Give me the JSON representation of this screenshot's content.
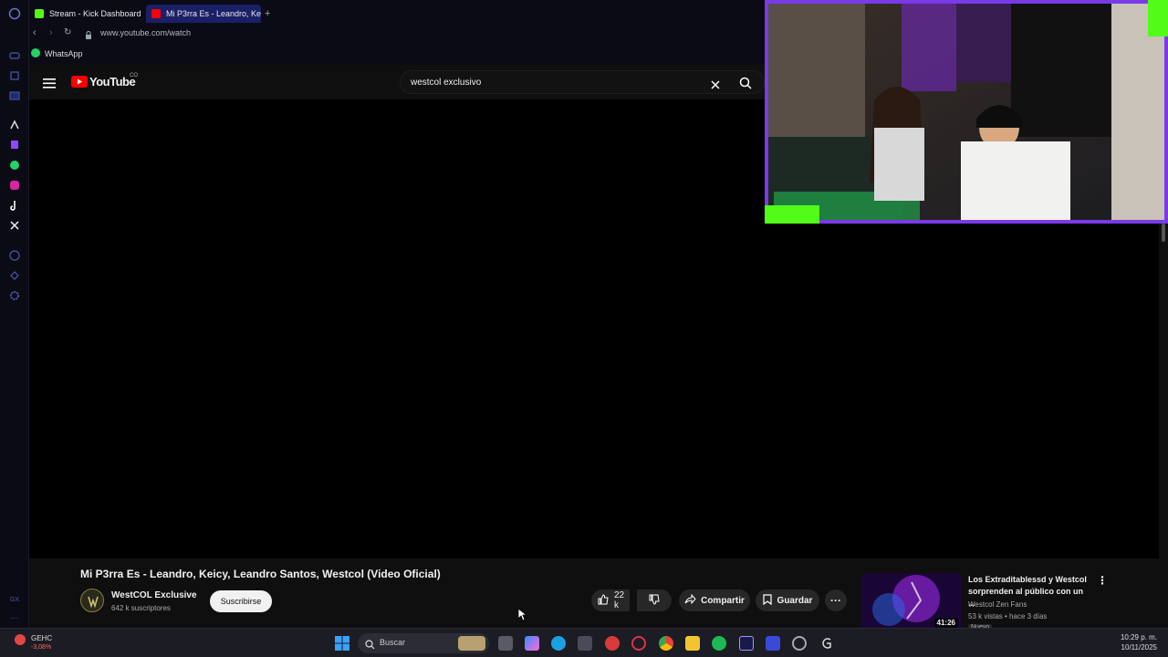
{
  "browser": {
    "tabs": [
      {
        "label": "Stream - Kick Dashboard"
      },
      {
        "label": "Mi P3rra Es - Leandro, Ke"
      }
    ],
    "new_tab": "+",
    "url": "www.youtube.com/watch",
    "bookmark": "WhatsApp"
  },
  "youtube": {
    "logo": "YouTube",
    "country": "CO",
    "search_value": "westcol exclusivo",
    "video": {
      "title": "Mi P3rra Es - Leandro, Keicy, Leandro Santos, Westcol (Video Oficial)",
      "channel": "WestCOL Exclusive",
      "subscribers": "642 k suscriptores",
      "subscribe_label": "Suscribirse",
      "likes": "22 k",
      "share_label": "Compartir",
      "save_label": "Guardar"
    },
    "recommended": {
      "title": "Los Extraditablessd y Westcol sorprenden al público con un ...",
      "channel": "Westcol Zen Fans",
      "meta": "53 k vistas • hace 3 días",
      "duration": "41:26",
      "badge": "Nuevo"
    }
  },
  "taskbar": {
    "stock_name": "GEHC",
    "stock_change": "-3,08%",
    "search_label": "Buscar",
    "time": "10:29 p. m.",
    "date": "10/11/2025"
  },
  "colors": {
    "yt_red": "#ff0000",
    "kick_green": "#53fc18",
    "stock_red": "#ff6b6b"
  }
}
